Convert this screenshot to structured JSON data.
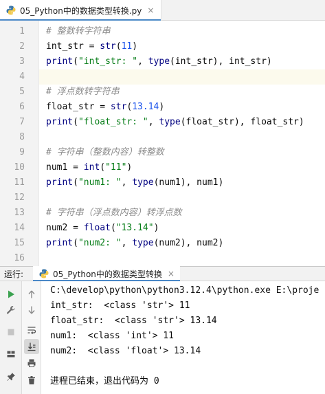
{
  "editor_tab": {
    "filename": "05_Python中的数据类型转换.py",
    "close_glyph": "×"
  },
  "code_lines": [
    {
      "num": "1",
      "tokens": [
        {
          "t": "# 整数转字符串",
          "c": "comment"
        }
      ]
    },
    {
      "num": "2",
      "tokens": [
        {
          "t": "int_str = ",
          "c": "plain"
        },
        {
          "t": "str",
          "c": "builtin"
        },
        {
          "t": "(",
          "c": "plain"
        },
        {
          "t": "11",
          "c": "number"
        },
        {
          "t": ")",
          "c": "plain"
        }
      ]
    },
    {
      "num": "3",
      "tokens": [
        {
          "t": "print",
          "c": "builtin"
        },
        {
          "t": "(",
          "c": "plain"
        },
        {
          "t": "\"int_str: \"",
          "c": "string"
        },
        {
          "t": ", ",
          "c": "plain"
        },
        {
          "t": "type",
          "c": "builtin"
        },
        {
          "t": "(int_str), int_str)",
          "c": "plain"
        }
      ]
    },
    {
      "num": "4",
      "tokens": [],
      "current": true
    },
    {
      "num": "5",
      "tokens": [
        {
          "t": "# 浮点数转字符串",
          "c": "comment"
        }
      ]
    },
    {
      "num": "6",
      "tokens": [
        {
          "t": "float_str = ",
          "c": "plain"
        },
        {
          "t": "str",
          "c": "builtin"
        },
        {
          "t": "(",
          "c": "plain"
        },
        {
          "t": "13.14",
          "c": "number"
        },
        {
          "t": ")",
          "c": "plain"
        }
      ]
    },
    {
      "num": "7",
      "tokens": [
        {
          "t": "print",
          "c": "builtin"
        },
        {
          "t": "(",
          "c": "plain"
        },
        {
          "t": "\"float_str: \"",
          "c": "string"
        },
        {
          "t": ", ",
          "c": "plain"
        },
        {
          "t": "type",
          "c": "builtin"
        },
        {
          "t": "(float_str), float_str)",
          "c": "plain"
        }
      ]
    },
    {
      "num": "8",
      "tokens": []
    },
    {
      "num": "9",
      "tokens": [
        {
          "t": "# 字符串（整数内容）转整数",
          "c": "comment"
        }
      ]
    },
    {
      "num": "10",
      "tokens": [
        {
          "t": "num1 = ",
          "c": "plain"
        },
        {
          "t": "int",
          "c": "builtin"
        },
        {
          "t": "(",
          "c": "plain"
        },
        {
          "t": "\"11\"",
          "c": "string"
        },
        {
          "t": ")",
          "c": "plain"
        }
      ]
    },
    {
      "num": "11",
      "tokens": [
        {
          "t": "print",
          "c": "builtin"
        },
        {
          "t": "(",
          "c": "plain"
        },
        {
          "t": "\"num1: \"",
          "c": "string"
        },
        {
          "t": ", ",
          "c": "plain"
        },
        {
          "t": "type",
          "c": "builtin"
        },
        {
          "t": "(num1), num1)",
          "c": "plain"
        }
      ]
    },
    {
      "num": "12",
      "tokens": []
    },
    {
      "num": "13",
      "tokens": [
        {
          "t": "# 字符串（浮点数内容）转浮点数",
          "c": "comment"
        }
      ]
    },
    {
      "num": "14",
      "tokens": [
        {
          "t": "num2 = ",
          "c": "plain"
        },
        {
          "t": "float",
          "c": "builtin"
        },
        {
          "t": "(",
          "c": "plain"
        },
        {
          "t": "\"13.14\"",
          "c": "string"
        },
        {
          "t": ")",
          "c": "plain"
        }
      ]
    },
    {
      "num": "15",
      "tokens": [
        {
          "t": "print",
          "c": "builtin"
        },
        {
          "t": "(",
          "c": "plain"
        },
        {
          "t": "\"num2: \"",
          "c": "string"
        },
        {
          "t": ", ",
          "c": "plain"
        },
        {
          "t": "type",
          "c": "builtin"
        },
        {
          "t": "(num2), num2)",
          "c": "plain"
        }
      ]
    },
    {
      "num": "16",
      "tokens": []
    }
  ],
  "run_panel": {
    "title": "运行:",
    "tab_label": "05_Python中的数据类型转换",
    "close_glyph": "×",
    "command": "C:\\develop\\python\\python3.12.4\\python.exe E:\\proje",
    "output": [
      "int_str:  <class 'str'> 11",
      "float_str:  <class 'str'> 13.14",
      "num1:  <class 'int'> 11",
      "num2:  <class 'float'> 13.14"
    ],
    "exit_message": "进程已结束，退出代码为 0"
  },
  "icons": {
    "tab": "python-file-icon",
    "run_tab": "python-run-icon",
    "left_toolbar": [
      "rerun-icon",
      "wrench-icon",
      "stop-icon",
      "layout-icon",
      "pin-icon"
    ],
    "second_toolbar": [
      "scroll-up-icon",
      "scroll-down-icon",
      "soft-wrap-icon",
      "scroll-to-end-icon",
      "print-icon",
      "trash-icon"
    ]
  },
  "colors": {
    "accent": "#4a88c7",
    "comment": "#8c8c8c",
    "builtin": "#000080",
    "string": "#067d17",
    "number": "#1750eb",
    "run_green": "#3aa14f"
  }
}
